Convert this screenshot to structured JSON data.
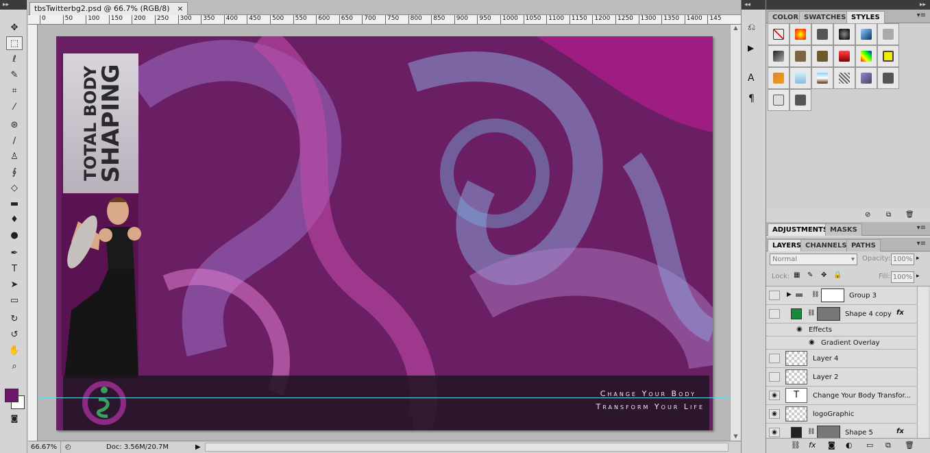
{
  "document": {
    "tab_title": "tbsTwitterbg2.psd @ 66.7% (RGB/8)",
    "close_glyph": "×",
    "ruler_marks": [
      "0",
      "50",
      "100",
      "150",
      "200",
      "250",
      "300",
      "350",
      "400",
      "450",
      "500",
      "550",
      "600",
      "650",
      "700",
      "750",
      "800",
      "850",
      "900",
      "950",
      "1000",
      "1050",
      "1100",
      "1150",
      "1200",
      "1250",
      "1300",
      "1350",
      "1400",
      "145"
    ]
  },
  "canvas": {
    "brand_line1": "TOTAL BODY",
    "brand_line2": "SHAPING",
    "tagline1": "Change Your Body",
    "tagline2": "Transform Your Life"
  },
  "status": {
    "zoom": "66.67%",
    "doc": "Doc: 3.56M/20.7M"
  },
  "colors": {
    "foreground": "#6e1669",
    "background": "#ffffff",
    "guide": "#5fd8e8"
  },
  "styles_panel": {
    "tabs": [
      "COLOR",
      "SWATCHES",
      "STYLES"
    ],
    "active_tab": "STYLES"
  },
  "adjust_panel": {
    "tabs": [
      "ADJUSTMENTS",
      "MASKS"
    ]
  },
  "layers_panel": {
    "tabs": [
      "LAYERS",
      "CHANNELS",
      "PATHS"
    ],
    "blend_mode": "Normal",
    "opacity_label": "Opacity:",
    "opacity": "100%",
    "lock_label": "Lock:",
    "fill_label": "Fill:",
    "fill": "100%",
    "layers": [
      {
        "name": "Group 3",
        "visible": false
      },
      {
        "name": "Shape 4 copy",
        "visible": false,
        "fx": "fx"
      },
      {
        "name": "Effects"
      },
      {
        "name": "Gradient Overlay"
      },
      {
        "name": "Layer 4",
        "visible": false
      },
      {
        "name": "Layer 2",
        "visible": false
      },
      {
        "name": "Change Your Body Transfor...",
        "visible": true
      },
      {
        "name": "logoGraphic",
        "visible": true
      },
      {
        "name": "Shape 5",
        "visible": true,
        "fx": "fx"
      }
    ]
  }
}
